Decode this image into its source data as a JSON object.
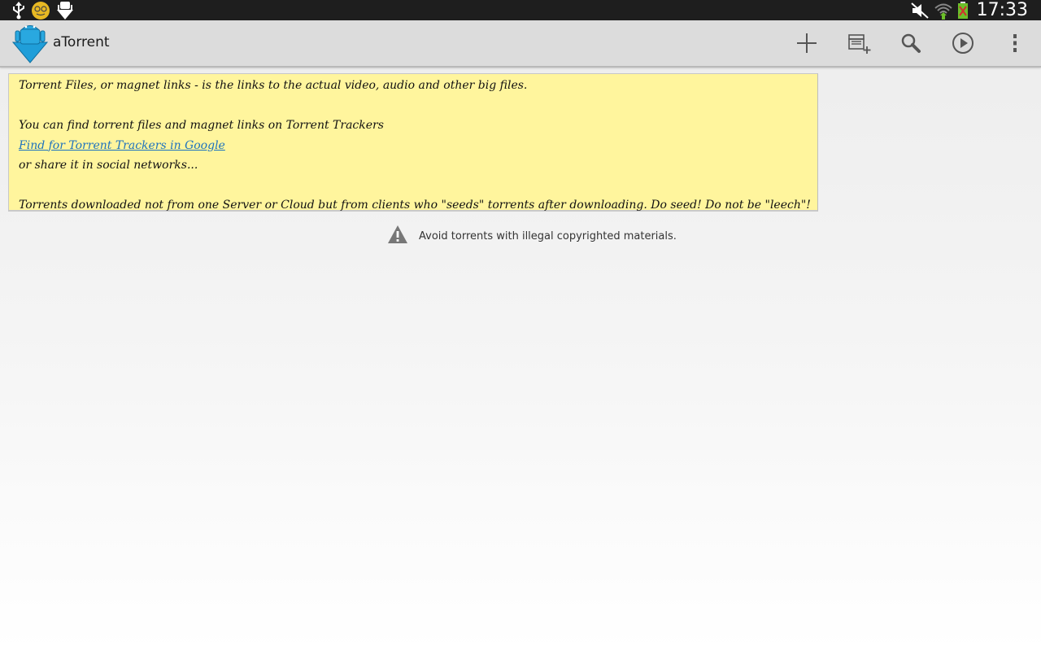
{
  "status_bar": {
    "time": "17:33",
    "left_icons": [
      "usb-icon",
      "notification-app-icon",
      "download-icon"
    ],
    "right_icons": [
      "mute-icon",
      "wifi-icon",
      "battery-icon"
    ]
  },
  "action_bar": {
    "app_title": "aTorrent",
    "actions": [
      "add-icon",
      "add-folder-icon",
      "search-icon",
      "play-icon",
      "overflow-menu-icon"
    ]
  },
  "note": {
    "line1": "Torrent Files, or magnet links - is the links to the actual video, audio and other big files.",
    "line3": " You can find torrent files and magnet links on Torrent Trackers",
    "link": "Find for Torrent Trackers in Google",
    "line5": "or share it in social networks...",
    "line7": " Torrents downloaded not from one Server or Cloud but from clients who \"seeds\" torrents after downloading. Do seed! Do not be \"leech\"!"
  },
  "warning": {
    "text": "Avoid torrents with illegal copyrighted materials."
  },
  "colors": {
    "status_bar": "#1e1e1e",
    "action_bar": "#dcdcdc",
    "note_background": "#fff59d",
    "link": "#1e73be"
  }
}
